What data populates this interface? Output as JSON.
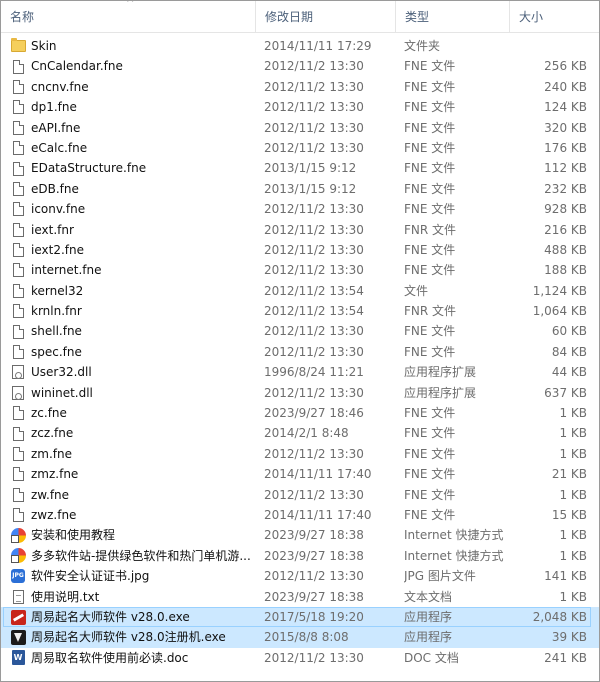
{
  "header": {
    "name": "名称",
    "date": "修改日期",
    "type": "类型",
    "size": "大小",
    "sort_glyph": "^"
  },
  "files": [
    {
      "name": "Skin",
      "date": "2014/11/11 17:29",
      "type": "文件夹",
      "size": "",
      "icon": "folder"
    },
    {
      "name": "CnCalendar.fne",
      "date": "2012/11/2 13:30",
      "type": "FNE 文件",
      "size": "256 KB",
      "icon": "file"
    },
    {
      "name": "cncnv.fne",
      "date": "2012/11/2 13:30",
      "type": "FNE 文件",
      "size": "240 KB",
      "icon": "file"
    },
    {
      "name": "dp1.fne",
      "date": "2012/11/2 13:30",
      "type": "FNE 文件",
      "size": "124 KB",
      "icon": "file"
    },
    {
      "name": "eAPI.fne",
      "date": "2012/11/2 13:30",
      "type": "FNE 文件",
      "size": "320 KB",
      "icon": "file"
    },
    {
      "name": "eCalc.fne",
      "date": "2012/11/2 13:30",
      "type": "FNE 文件",
      "size": "176 KB",
      "icon": "file"
    },
    {
      "name": "EDataStructure.fne",
      "date": "2013/1/15 9:12",
      "type": "FNE 文件",
      "size": "112 KB",
      "icon": "file"
    },
    {
      "name": "eDB.fne",
      "date": "2013/1/15 9:12",
      "type": "FNE 文件",
      "size": "232 KB",
      "icon": "file"
    },
    {
      "name": "iconv.fne",
      "date": "2012/11/2 13:30",
      "type": "FNE 文件",
      "size": "928 KB",
      "icon": "file"
    },
    {
      "name": "iext.fnr",
      "date": "2012/11/2 13:30",
      "type": "FNR 文件",
      "size": "216 KB",
      "icon": "file"
    },
    {
      "name": "iext2.fne",
      "date": "2012/11/2 13:30",
      "type": "FNE 文件",
      "size": "488 KB",
      "icon": "file"
    },
    {
      "name": "internet.fne",
      "date": "2012/11/2 13:30",
      "type": "FNE 文件",
      "size": "188 KB",
      "icon": "file"
    },
    {
      "name": "kernel32",
      "date": "2012/11/2 13:54",
      "type": "文件",
      "size": "1,124 KB",
      "icon": "file"
    },
    {
      "name": "krnln.fnr",
      "date": "2012/11/2 13:54",
      "type": "FNR 文件",
      "size": "1,064 KB",
      "icon": "file"
    },
    {
      "name": "shell.fne",
      "date": "2012/11/2 13:30",
      "type": "FNE 文件",
      "size": "60 KB",
      "icon": "file"
    },
    {
      "name": "spec.fne",
      "date": "2012/11/2 13:30",
      "type": "FNE 文件",
      "size": "84 KB",
      "icon": "file"
    },
    {
      "name": "User32.dll",
      "date": "1996/8/24 11:21",
      "type": "应用程序扩展",
      "size": "44 KB",
      "icon": "dll"
    },
    {
      "name": "wininet.dll",
      "date": "2012/11/2 13:30",
      "type": "应用程序扩展",
      "size": "637 KB",
      "icon": "dll"
    },
    {
      "name": "zc.fne",
      "date": "2023/9/27 18:46",
      "type": "FNE 文件",
      "size": "1 KB",
      "icon": "file"
    },
    {
      "name": "zcz.fne",
      "date": "2014/2/1 8:48",
      "type": "FNE 文件",
      "size": "1 KB",
      "icon": "file"
    },
    {
      "name": "zm.fne",
      "date": "2012/11/2 13:30",
      "type": "FNE 文件",
      "size": "1 KB",
      "icon": "file"
    },
    {
      "name": "zmz.fne",
      "date": "2014/11/11 17:40",
      "type": "FNE 文件",
      "size": "21 KB",
      "icon": "file"
    },
    {
      "name": "zw.fne",
      "date": "2012/11/2 13:30",
      "type": "FNE 文件",
      "size": "1 KB",
      "icon": "file"
    },
    {
      "name": "zwz.fne",
      "date": "2014/11/11 17:40",
      "type": "FNE 文件",
      "size": "15 KB",
      "icon": "file"
    },
    {
      "name": "安装和使用教程",
      "date": "2023/9/27 18:38",
      "type": "Internet 快捷方式",
      "size": "1 KB",
      "icon": "link"
    },
    {
      "name": "多多软件站-提供绿色软件和热门单机游...",
      "date": "2023/9/27 18:38",
      "type": "Internet 快捷方式",
      "size": "1 KB",
      "icon": "link"
    },
    {
      "name": "软件安全认证证书.jpg",
      "date": "2012/11/2 13:30",
      "type": "JPG 图片文件",
      "size": "141 KB",
      "icon": "jpg"
    },
    {
      "name": "使用说明.txt",
      "date": "2023/9/27 18:38",
      "type": "文本文档",
      "size": "1 KB",
      "icon": "txt"
    },
    {
      "name": "周易起名大师软件 v28.0.exe",
      "date": "2017/5/18 19:20",
      "type": "应用程序",
      "size": "2,048 KB",
      "icon": "exe1",
      "state": "selected"
    },
    {
      "name": "周易起名大师软件 v28.0注册机.exe",
      "date": "2015/8/8 8:08",
      "type": "应用程序",
      "size": "39 KB",
      "icon": "exe2",
      "state": "highlighted"
    },
    {
      "name": "周易取名软件使用前必读.doc",
      "date": "2012/11/2 13:30",
      "type": "DOC 文档",
      "size": "241 KB",
      "icon": "doc"
    }
  ],
  "icon_labels": {
    "jpg": "JPG",
    "doc": "W"
  },
  "colors": {
    "selection": "#cce8ff",
    "selection_border": "#99d1ff",
    "header_text": "#4c607a"
  }
}
